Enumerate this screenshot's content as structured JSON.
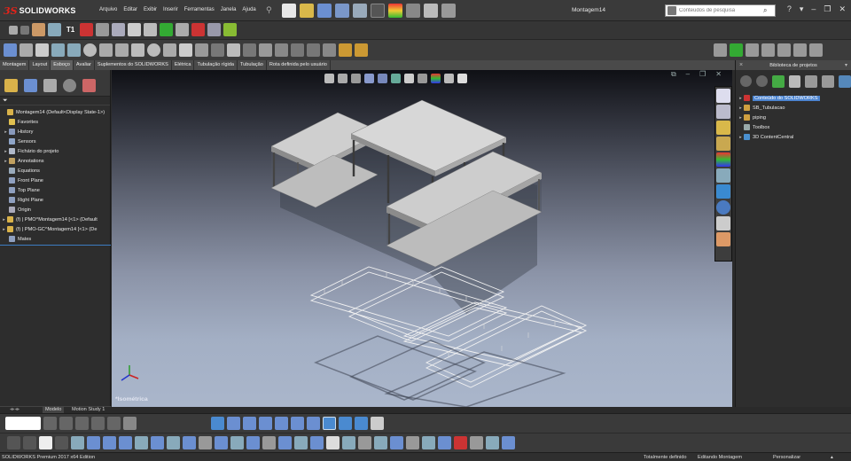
{
  "app": {
    "brand_ds": "3S",
    "brand_name": "SOLIDWORKS",
    "document_title": "Montagem14"
  },
  "menu": [
    "Arquivo",
    "Editar",
    "Exibir",
    "Inserir",
    "Ferramentas",
    "Janela",
    "Ajuda"
  ],
  "search": {
    "placeholder": "Conteúdos de pesquisa"
  },
  "window_controls": [
    "?",
    "▾",
    "–",
    "❐",
    "✕"
  ],
  "toolbar_row2": {
    "t1_label": "T1"
  },
  "tabs": [
    {
      "label": "Montagem",
      "active": false
    },
    {
      "label": "Layout",
      "active": false
    },
    {
      "label": "Esboço",
      "active": true
    },
    {
      "label": "Avaliar",
      "active": false
    },
    {
      "label": "Suplementos do SOLIDWORKS",
      "active": false
    },
    {
      "label": "Elétrica",
      "active": false
    },
    {
      "label": "Tubulação rígida",
      "active": false
    },
    {
      "label": "Tubulação",
      "active": false
    },
    {
      "label": "Rota definida pelo usuário",
      "active": false
    }
  ],
  "feature_tree": {
    "filter_icon": "funnel-icon",
    "nodes": [
      {
        "label": "Montagem14  (Default<Display State-1>)",
        "expand": "",
        "indent": 0,
        "icon": "assembly-icon",
        "color": "#d9b24a"
      },
      {
        "label": "Favorites",
        "expand": "",
        "indent": 1,
        "icon": "star-icon",
        "color": "#e0c050"
      },
      {
        "label": "History",
        "expand": "▸",
        "indent": 1,
        "icon": "history-icon",
        "color": "#8899bb"
      },
      {
        "label": "Sensors",
        "expand": "",
        "indent": 1,
        "icon": "sensor-icon",
        "color": "#8fa5c8"
      },
      {
        "label": "Fichário do projeto",
        "expand": "▸",
        "indent": 1,
        "icon": "binder-icon",
        "color": "#b0b8c8"
      },
      {
        "label": "Annotations",
        "expand": "▸",
        "indent": 1,
        "icon": "annotation-icon",
        "color": "#c0a060"
      },
      {
        "label": "Equations",
        "expand": "",
        "indent": 1,
        "icon": "equation-icon",
        "color": "#9ab"
      },
      {
        "label": "Front Plane",
        "expand": "",
        "indent": 1,
        "icon": "plane-icon",
        "color": "#8fa0c0"
      },
      {
        "label": "Top Plane",
        "expand": "",
        "indent": 1,
        "icon": "plane-icon",
        "color": "#8fa0c0"
      },
      {
        "label": "Right Plane",
        "expand": "",
        "indent": 1,
        "icon": "plane-icon",
        "color": "#8fa0c0"
      },
      {
        "label": "Origin",
        "expand": "",
        "indent": 1,
        "icon": "origin-icon",
        "color": "#aab"
      },
      {
        "label": "(f) | PMO^Montagem14 [<1> (Default",
        "expand": "▸",
        "indent": 0,
        "icon": "subassembly-icon",
        "color": "#d9b24a"
      },
      {
        "label": "(f) | PMO-GC^Montagem14 [<1> (De",
        "expand": "▸",
        "indent": 0,
        "icon": "subassembly-icon",
        "color": "#d9b24a"
      },
      {
        "label": "Mates",
        "expand": "",
        "indent": 1,
        "icon": "mates-icon",
        "color": "#8fa0c0"
      }
    ]
  },
  "viewport": {
    "view_label": "*Isométrica"
  },
  "design_library": {
    "title": "Biblioteca de projetos",
    "items": [
      {
        "label": "Conteúdo do SOLIDWORKS",
        "selected": true,
        "icon": "solidworks-content-icon",
        "color": "#cc3333"
      },
      {
        "label": "SB_Tubulacao",
        "selected": false,
        "icon": "folder-icon",
        "color": "#d0a040"
      },
      {
        "label": "piping",
        "selected": false,
        "icon": "folder-icon",
        "color": "#d0a040"
      },
      {
        "label": "Toolbox",
        "selected": false,
        "icon": "toolbox-icon",
        "color": "#9aa"
      },
      {
        "label": "3D ContentCentral",
        "selected": false,
        "icon": "globe-icon",
        "color": "#4a90d0"
      }
    ]
  },
  "model_tabs": [
    "Modelo",
    "Motion Study 1"
  ],
  "status": {
    "edition": "SOLIDWORKS Premium 2017 x64 Edition",
    "definition": "Totalmente definido",
    "editing": "Editando Montagem",
    "customize": "Personalizar"
  },
  "colors": {
    "accent": "#4c84d0",
    "brand_red": "#e2231a",
    "panel": "#2d2d2d"
  }
}
